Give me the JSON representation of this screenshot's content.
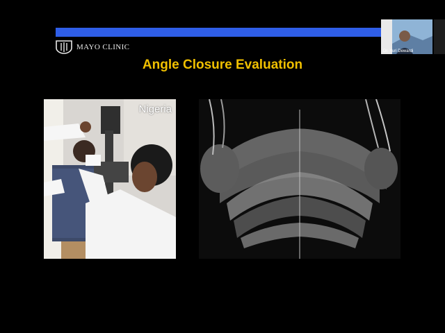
{
  "slide": {
    "logo_text": "MAYO CLINIC",
    "title": "Angle Closure Evaluation",
    "photo_label": "Nigeria"
  },
  "video": {
    "participant_name": "Dr. Yuri Dewardi"
  }
}
